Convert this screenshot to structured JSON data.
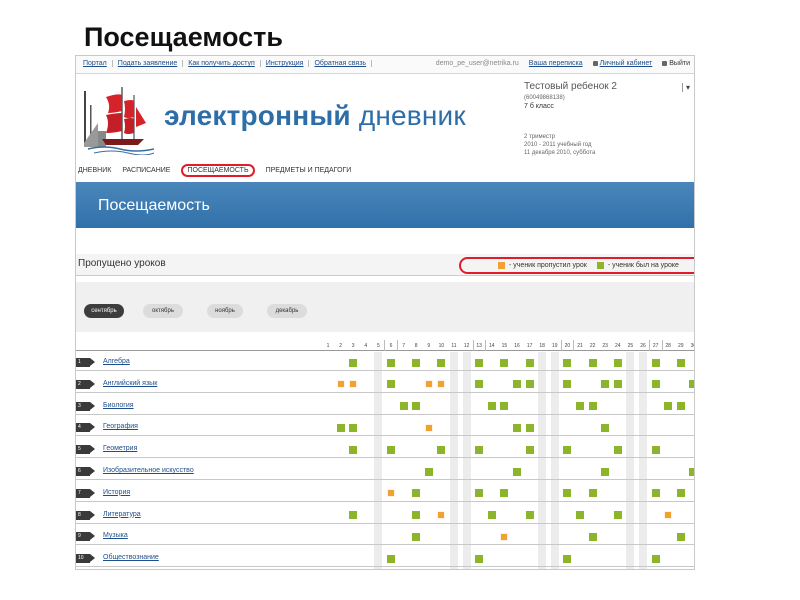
{
  "slide": {
    "title": "Посещаемость"
  },
  "topbar": {
    "links": [
      "Портал",
      "Подать заявление",
      "Как получить доступ",
      "Инструкция",
      "Обратная связь"
    ],
    "user_email": "demo_pe_user@netrika.ru",
    "messages_link": "Ваша переписка",
    "cabinet_link": "Личный кабинет",
    "exit_link": "Выйти"
  },
  "header": {
    "brand_part1": "электронный",
    "brand_part2": " дневник"
  },
  "student": {
    "name": "Тестовый ребенок 2",
    "id": "(60049868138)",
    "class": "7 б класс",
    "term": "2 триместр",
    "year": "2010 - 2011 учебный год",
    "date": "11 декабря 2010, суббота",
    "caret": "▾"
  },
  "nav": [
    "ДНЕВНИК",
    "РАСПИСАНИЕ",
    "ПОСЕЩАЕМОСТЬ",
    "ПРЕДМЕТЫ И ПЕДАГОГИ"
  ],
  "nav_active": 2,
  "banner": {
    "title": "Посещаемость"
  },
  "missed": {
    "label": "Пропущено уроков",
    "legend_missed": "- ученик пропустил урок",
    "legend_present": "- ученик был на уроке"
  },
  "colors": {
    "present": "#8db52b",
    "missed": "#f0a133",
    "highlight": "#e21b2a",
    "banner": "#3a78af"
  },
  "months": [
    "сентябрь",
    "октябрь",
    "ноябрь",
    "декабрь"
  ],
  "month_selected": 0,
  "days": [
    "1",
    "2",
    "3",
    "4",
    "5",
    "6",
    "7",
    "8",
    "9",
    "10",
    "11",
    "12",
    "13",
    "14",
    "15",
    "16",
    "17",
    "18",
    "19",
    "20",
    "21",
    "22",
    "23",
    "24",
    "25",
    "26",
    "27",
    "28",
    "29",
    "30"
  ],
  "weekend_days": [
    5,
    11,
    12,
    18,
    19,
    25,
    26
  ],
  "subjects": [
    {
      "num": "1",
      "name": "Алгебра",
      "marks": {
        "3": "g",
        "6": "g",
        "8": "g",
        "10": "g",
        "13": "g",
        "15": "g",
        "17": "g",
        "20": "g",
        "22": "g",
        "24": "g",
        "27": "g",
        "29": "g"
      }
    },
    {
      "num": "2",
      "name": "Английский язык",
      "marks": {
        "2": "o",
        "3": "o",
        "6": "g",
        "9": "o",
        "10": "o",
        "13": "g",
        "16": "g",
        "17": "g",
        "20": "g",
        "23": "g",
        "24": "g",
        "27": "g",
        "30": "g"
      }
    },
    {
      "num": "3",
      "name": "Биология",
      "marks": {
        "7": "g",
        "8": "g",
        "14": "g",
        "15": "g",
        "21": "g",
        "22": "g",
        "28": "g",
        "29": "g"
      }
    },
    {
      "num": "4",
      "name": "География",
      "marks": {
        "2": "g",
        "3": "g",
        "9": "o",
        "16": "g",
        "17": "g",
        "23": "g"
      }
    },
    {
      "num": "5",
      "name": "Геометрия",
      "marks": {
        "3": "g",
        "6": "g",
        "10": "g",
        "13": "g",
        "17": "g",
        "20": "g",
        "24": "g",
        "27": "g"
      }
    },
    {
      "num": "6",
      "name": "Изобразительное искусство",
      "marks": {
        "9": "g",
        "16": "g",
        "23": "g",
        "30": "g"
      }
    },
    {
      "num": "7",
      "name": "История",
      "marks": {
        "6": "o",
        "8": "g",
        "13": "g",
        "15": "g",
        "20": "g",
        "22": "g",
        "27": "g",
        "29": "g"
      }
    },
    {
      "num": "8",
      "name": "Литература",
      "marks": {
        "3": "g",
        "8": "g",
        "10": "o",
        "14": "g",
        "17": "g",
        "21": "g",
        "24": "g",
        "28": "o"
      }
    },
    {
      "num": "9",
      "name": "Музыка",
      "marks": {
        "8": "g",
        "15": "o",
        "22": "g",
        "29": "g"
      }
    },
    {
      "num": "10",
      "name": "Обществознание",
      "marks": {
        "6": "g",
        "13": "g",
        "20": "g",
        "27": "g"
      }
    }
  ]
}
